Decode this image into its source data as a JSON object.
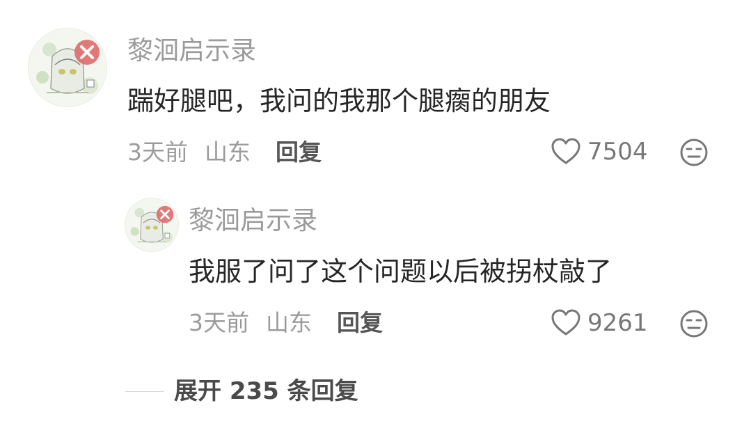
{
  "comments": [
    {
      "username": "黎洄启示录",
      "content": "踹好腿吧，我问的我那个腿瘸的朋友",
      "time": "3天前",
      "location": "山东",
      "reply_label": "回复",
      "likes": "7504"
    },
    {
      "username": "黎洄启示录",
      "content": "我服了问了这个问题以后被拐杖敲了",
      "time": "3天前",
      "location": "山东",
      "reply_label": "回复",
      "likes": "9261"
    }
  ],
  "expand_replies": "展开 235 条回复",
  "icons": {
    "like": "heart-icon",
    "dislike": "neutral-face-icon",
    "avatar_badge": "close-badge-icon"
  },
  "colors": {
    "username": "#9b9b9b",
    "content": "#262626",
    "meta": "#9b9b9b",
    "badge": "#e06b6b"
  }
}
